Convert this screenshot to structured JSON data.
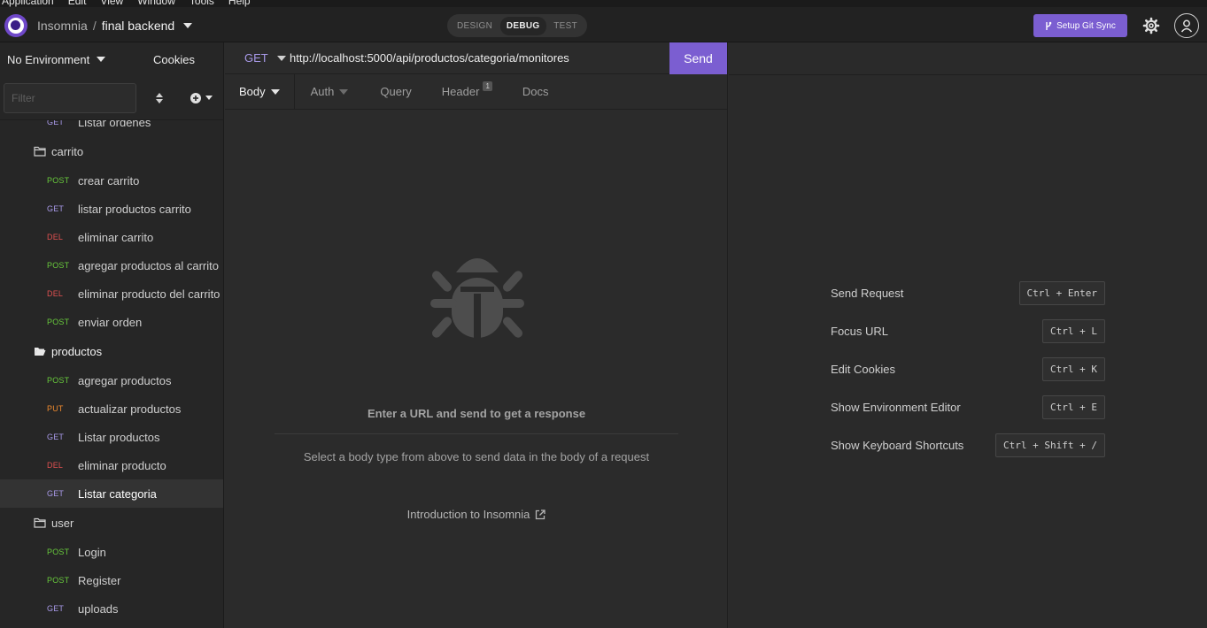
{
  "os_menu": [
    "Application",
    "Edit",
    "View",
    "Window",
    "Tools",
    "Help"
  ],
  "header": {
    "app_name": "Insomnia",
    "separator": "/",
    "workspace": "final backend",
    "modes": [
      "DESIGN",
      "DEBUG",
      "TEST"
    ],
    "active_mode": "DEBUG",
    "git_sync_label": "Setup Git Sync"
  },
  "sidebar": {
    "environment": "No Environment",
    "cookies_label": "Cookies",
    "filter_placeholder": "Filter",
    "tree": [
      {
        "kind": "request",
        "method": "GET",
        "name": "Listar ordenes"
      },
      {
        "kind": "folder",
        "name": "carrito",
        "open": false
      },
      {
        "kind": "request",
        "method": "POST",
        "name": "crear carrito"
      },
      {
        "kind": "request",
        "method": "GET",
        "name": "listar productos carrito"
      },
      {
        "kind": "request",
        "method": "DEL",
        "name": "eliminar carrito"
      },
      {
        "kind": "request",
        "method": "POST",
        "name": "agregar productos al carrito"
      },
      {
        "kind": "request",
        "method": "DEL",
        "name": "eliminar producto del carrito"
      },
      {
        "kind": "request",
        "method": "POST",
        "name": "enviar orden"
      },
      {
        "kind": "folder",
        "name": "productos",
        "open": true
      },
      {
        "kind": "request",
        "method": "POST",
        "name": "agregar productos"
      },
      {
        "kind": "request",
        "method": "PUT",
        "name": "actualizar productos"
      },
      {
        "kind": "request",
        "method": "GET",
        "name": "Listar productos"
      },
      {
        "kind": "request",
        "method": "DEL",
        "name": "eliminar producto"
      },
      {
        "kind": "request",
        "method": "GET",
        "name": "Listar categoria",
        "active": true
      },
      {
        "kind": "folder",
        "name": "user",
        "open": false
      },
      {
        "kind": "request",
        "method": "POST",
        "name": "Login"
      },
      {
        "kind": "request",
        "method": "POST",
        "name": "Register"
      },
      {
        "kind": "request",
        "method": "GET",
        "name": "uploads"
      }
    ]
  },
  "request": {
    "method": "GET",
    "url": "http://localhost:5000/api/productos/categoria/monitores",
    "send_label": "Send",
    "tabs": {
      "body": "Body",
      "auth": "Auth",
      "query": "Query",
      "header": "Header",
      "header_count": "1",
      "docs": "Docs"
    },
    "empty_title": "Enter a URL and send to get a response",
    "empty_hint": "Select a body type from above to send data in the body of a request",
    "intro_link": "Introduction to Insomnia"
  },
  "shortcuts": [
    {
      "label": "Send Request",
      "keys": "Ctrl + Enter"
    },
    {
      "label": "Focus URL",
      "keys": "Ctrl + L"
    },
    {
      "label": "Edit Cookies",
      "keys": "Ctrl + K"
    },
    {
      "label": "Show Environment Editor",
      "keys": "Ctrl + E"
    },
    {
      "label": "Show Keyboard Shortcuts",
      "keys": "Ctrl + Shift + /"
    }
  ],
  "colors": {
    "accent": "#7b5ed1",
    "post": "#68c93c",
    "get": "#a899e8",
    "del": "#e05050",
    "put": "#ef8a2e"
  }
}
